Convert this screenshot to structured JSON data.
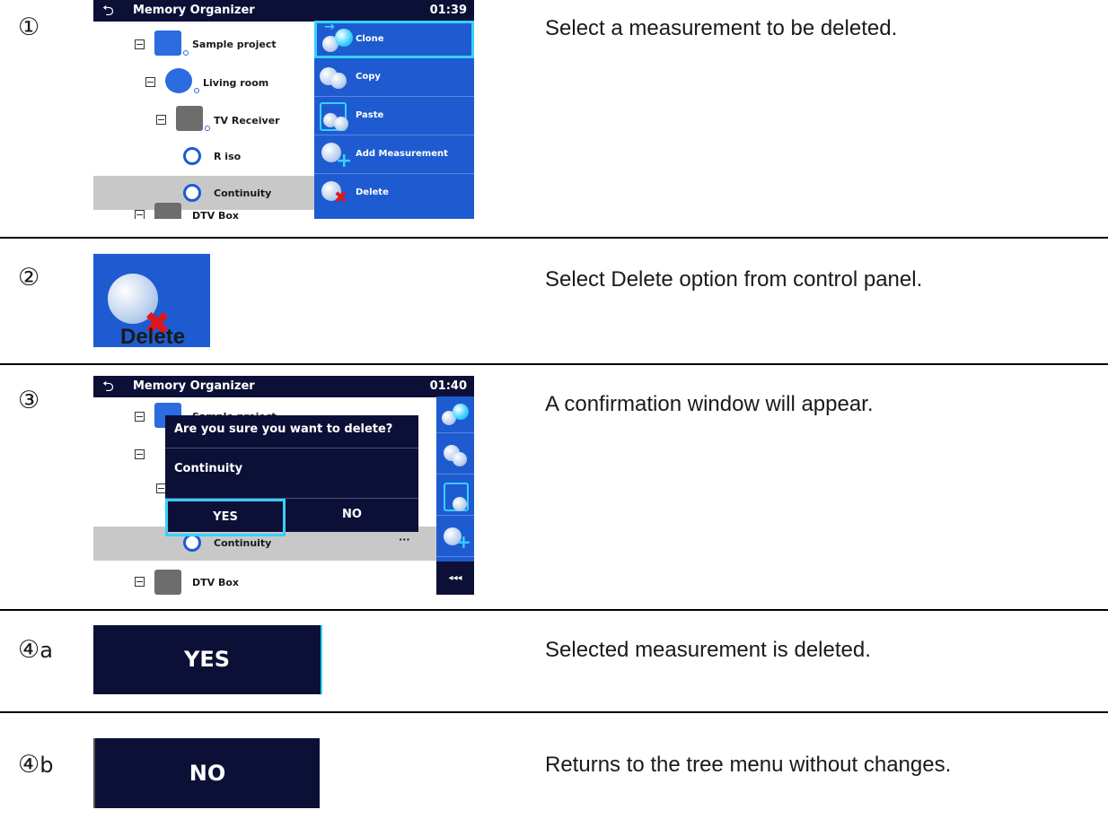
{
  "steps": {
    "s1": {
      "num": "①",
      "desc": "Select a measurement to be deleted."
    },
    "s2": {
      "num": "②",
      "desc": "Select Delete option from control panel."
    },
    "s3": {
      "num": "③",
      "desc": "A confirmation window will appear."
    },
    "s4a": {
      "num": "④",
      "suffix": "a",
      "desc": "Selected measurement is deleted."
    },
    "s4b": {
      "num": "④",
      "suffix": "b",
      "desc": "Returns to the tree menu without changes."
    }
  },
  "screen1": {
    "title": "Memory Organizer",
    "clock": "01:39",
    "tree": [
      "Sample project",
      "Living room",
      "TV Receiver",
      "R iso",
      "Continuity",
      "DTV Box"
    ],
    "menu": [
      "Clone",
      "Copy",
      "Paste",
      "Add Measurement",
      "Delete"
    ]
  },
  "delete_icon": {
    "label": "Delete"
  },
  "screen3": {
    "title": "Memory Organizer",
    "clock": "01:40",
    "tree": [
      "Sample project",
      "Continuity",
      "DTV Box"
    ],
    "dialog": {
      "question": "Are you sure you want to delete?",
      "item": "Continuity",
      "yes": "YES",
      "no": "NO"
    },
    "collapse": "◂◂◂"
  },
  "yes_button": {
    "label": "YES"
  },
  "no_button": {
    "label": "NO"
  },
  "colors": {
    "navy": "#0c1036",
    "blue": "#1e5bd0",
    "accent": "#37d0ff",
    "red": "#e0151b"
  }
}
